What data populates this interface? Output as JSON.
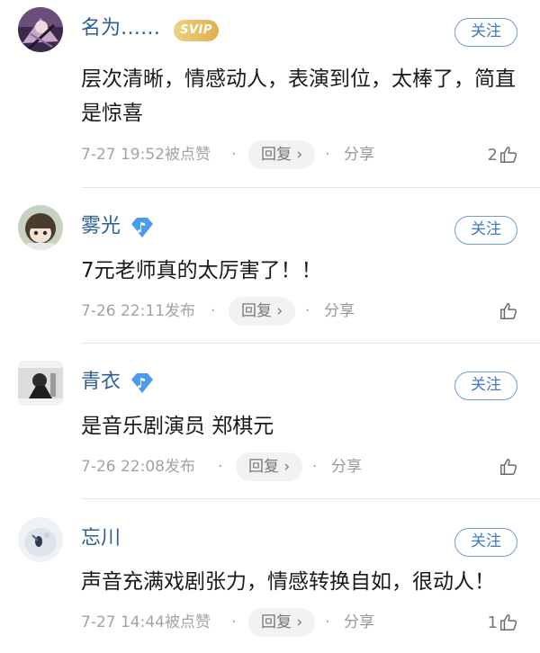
{
  "comments": [
    {
      "username": "名为……",
      "badge": "SVIP",
      "follow_label": "关注",
      "content": "层次清晰，情感动人，表演到位，太棒了，简直是惊喜",
      "meta": "7-27 19:52被点赞",
      "reply_label": "回复",
      "share_label": "分享",
      "likes": "2"
    },
    {
      "username": "雾光",
      "badge_icon": "music-verified-icon",
      "follow_label": "关注",
      "content": "7元老师真的太厉害了！！",
      "meta": "7-26 22:11发布",
      "reply_label": "回复",
      "share_label": "分享",
      "likes": ""
    },
    {
      "username": "青衣",
      "badge_icon": "music-verified-icon",
      "follow_label": "关注",
      "content": "是音乐剧演员 郑棋元",
      "meta": "7-26 22:08发布",
      "reply_label": "回复",
      "share_label": "分享",
      "likes": ""
    },
    {
      "username": "忘川",
      "follow_label": "关注",
      "content": "声音充满戏剧张力，情感转换自如，很动人！",
      "meta": "7-27 14:44被点赞",
      "reply_label": "回复",
      "share_label": "分享",
      "likes": "1"
    }
  ],
  "colors": {
    "username": "#2b5f97",
    "follow_border": "#6f9bd4",
    "svip_gold": "#e0b04c",
    "verified_blue": "#4a9cf0"
  }
}
